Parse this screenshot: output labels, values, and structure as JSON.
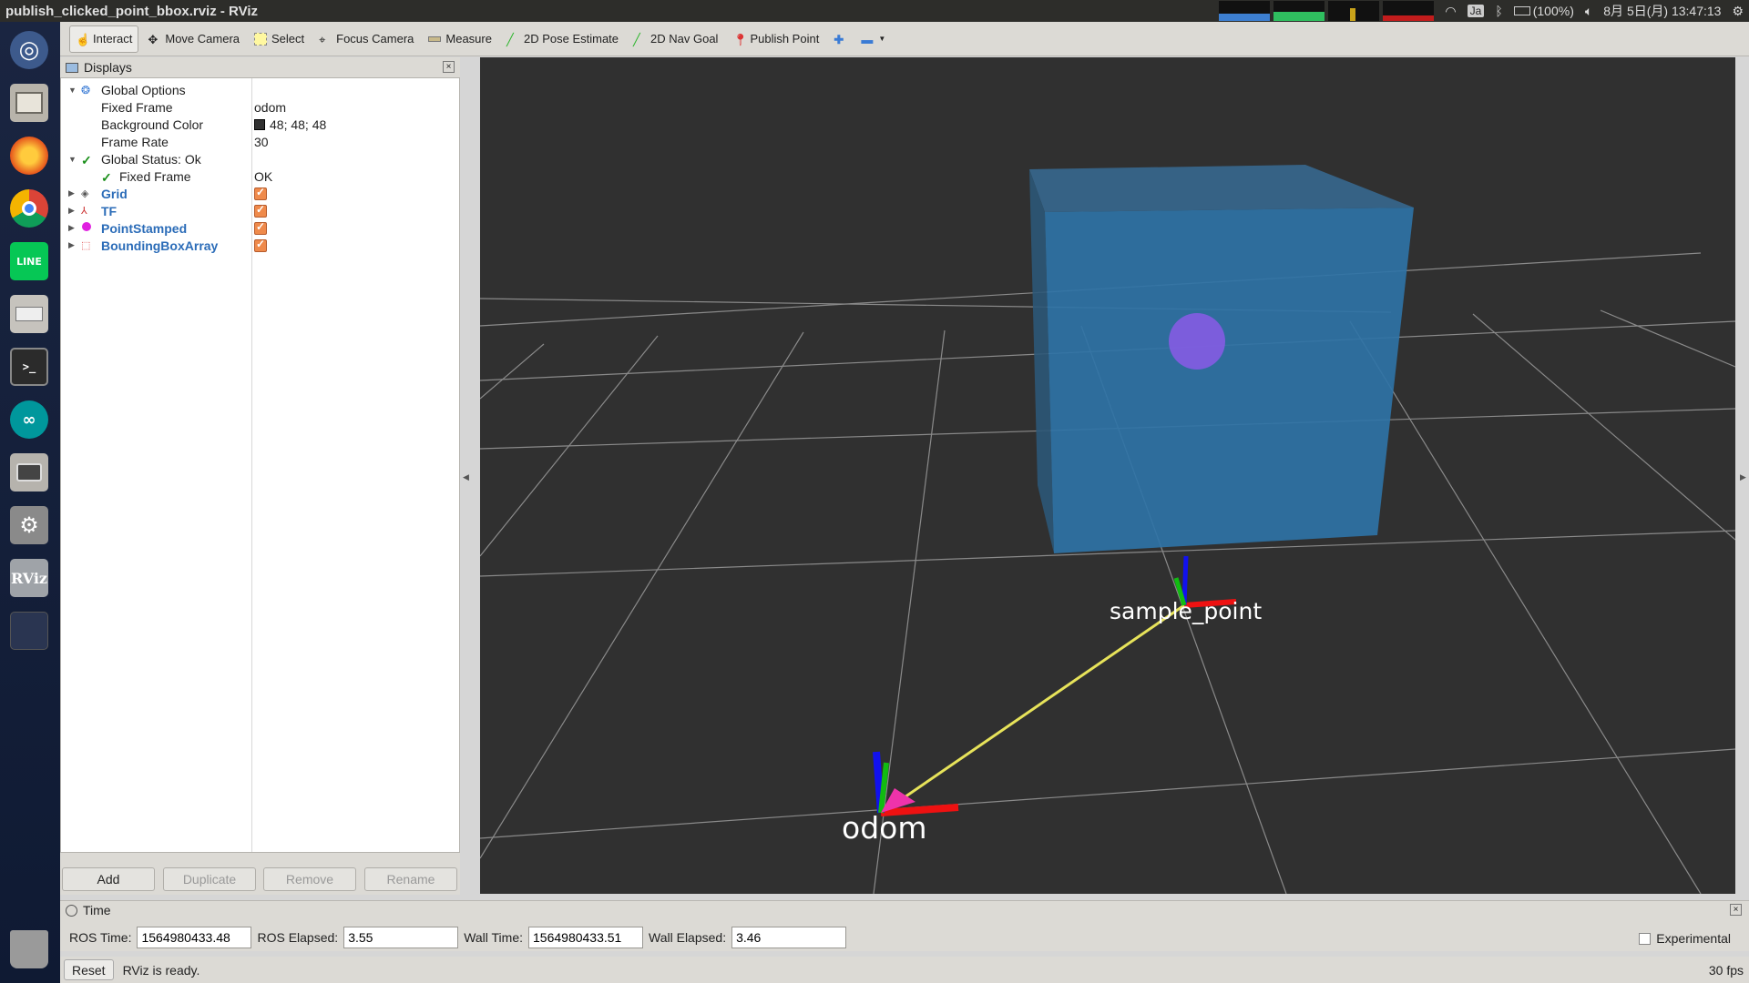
{
  "window": {
    "title": "publish_clicked_point_bbox.rviz - RViz"
  },
  "tray": {
    "input_method": "Ja",
    "battery": "(100%)",
    "datetime": "8月 5日(月) 13:47:13"
  },
  "launcher": {
    "items": [
      "dash-icon",
      "files-icon",
      "firefox-icon",
      "chrome-icon",
      "line-icon",
      "disk-icon",
      "terminal-icon",
      "arduino-icon",
      "camera-icon",
      "settings-icon",
      "rviz-icon",
      "workspace-icon",
      "trash-icon"
    ],
    "rviz_label": "RViz",
    "line_label": "LINE"
  },
  "toolbar": {
    "interact": "Interact",
    "move_camera": "Move Camera",
    "select": "Select",
    "focus_camera": "Focus Camera",
    "measure": "Measure",
    "pose_estimate": "2D Pose Estimate",
    "nav_goal": "2D Nav Goal",
    "publish_point": "Publish Point"
  },
  "displays": {
    "title": "Displays",
    "global_options": "Global Options",
    "fixed_frame_label": "Fixed Frame",
    "fixed_frame_value": "odom",
    "bg_color_label": "Background Color",
    "bg_color_value": "48; 48; 48",
    "frame_rate_label": "Frame Rate",
    "frame_rate_value": "30",
    "global_status": "Global Status: Ok",
    "status_fixed_frame": "Fixed Frame",
    "status_fixed_frame_value": "OK",
    "items": [
      "Grid",
      "TF",
      "PointStamped",
      "BoundingBoxArray"
    ],
    "buttons": {
      "add": "Add",
      "duplicate": "Duplicate",
      "remove": "Remove",
      "rename": "Rename"
    }
  },
  "view": {
    "background": "#303030",
    "frames": {
      "odom": "odom",
      "sample_point": "sample_point"
    }
  },
  "time": {
    "title": "Time",
    "ros_time_label": "ROS Time:",
    "ros_time": "1564980433.48",
    "ros_elapsed_label": "ROS Elapsed:",
    "ros_elapsed": "3.55",
    "wall_time_label": "Wall Time:",
    "wall_time": "1564980433.51",
    "wall_elapsed_label": "Wall Elapsed:",
    "wall_elapsed": "3.46",
    "experimental": "Experimental"
  },
  "status": {
    "reset": "Reset",
    "message": "RViz is ready.",
    "fps": "30 fps"
  }
}
